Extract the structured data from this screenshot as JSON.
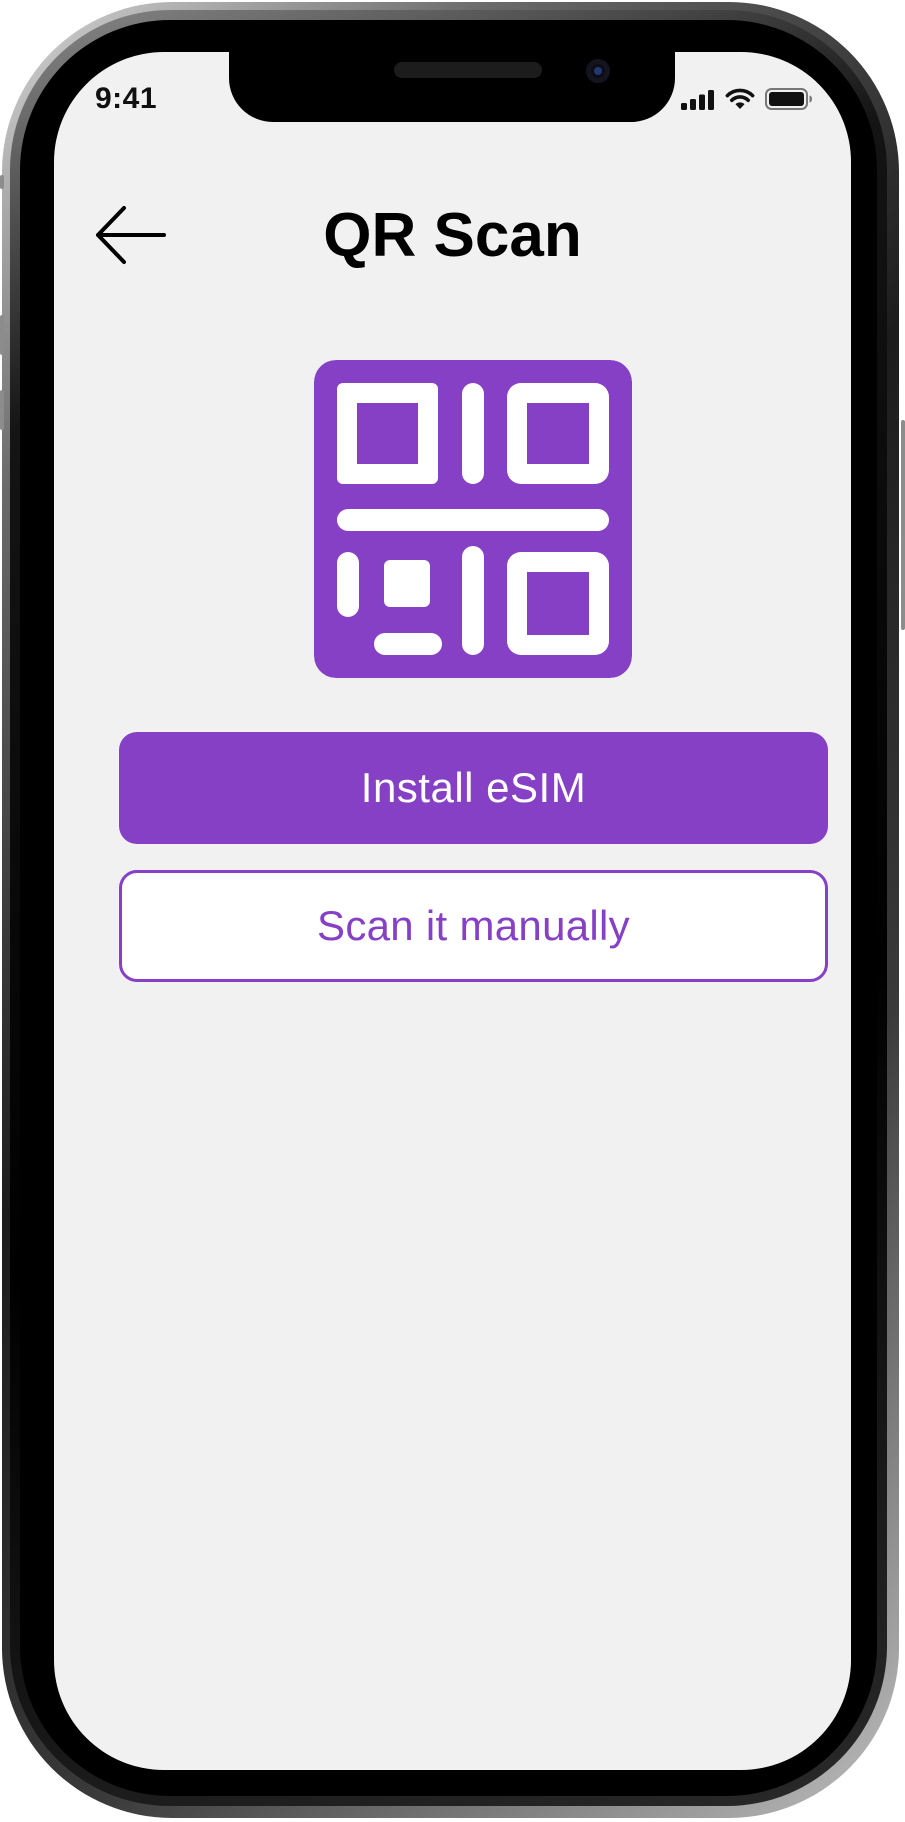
{
  "status_bar": {
    "time": "9:41",
    "icons": [
      "cellular-signal-icon",
      "wifi-icon",
      "battery-icon"
    ]
  },
  "header": {
    "title": "QR Scan",
    "back_icon": "arrow-left-icon"
  },
  "main": {
    "qr_icon": "qr-code-icon",
    "primary_button_label": "Install eSIM",
    "secondary_button_label": "Scan it manually"
  },
  "colors": {
    "accent": "#8540c6",
    "screen_background": "#f2f1f2",
    "text": "#000000"
  }
}
